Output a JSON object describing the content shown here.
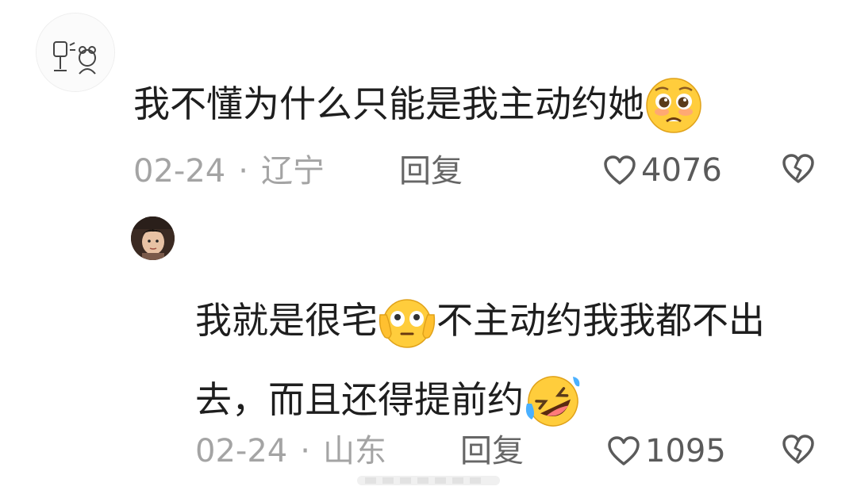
{
  "comment1": {
    "text_before_emoji": "我不懂为什么只能是我主动约她",
    "emoji_name": "pleading-face",
    "date": "02-24",
    "separator": "·",
    "location": "辽宁",
    "reply_label": "回复",
    "likes": "4076"
  },
  "comment2": {
    "text_part1": "我就是很宅",
    "emoji1_name": "hear-no-evil-face",
    "text_part2": "不主动约我我都不出去，而且还得提前约",
    "emoji2_name": "rolling-laughing-face",
    "date": "02-24",
    "separator": "·",
    "location": "山东",
    "reply_label": "回复",
    "likes": "1095"
  },
  "icons": {
    "like": "heart-outline-icon",
    "dislike": "broken-heart-icon"
  },
  "colors": {
    "text": "#1e1e1e",
    "meta": "#a4a4a4",
    "reply": "#666666",
    "emoji_yellow": "#ffcd3c"
  }
}
